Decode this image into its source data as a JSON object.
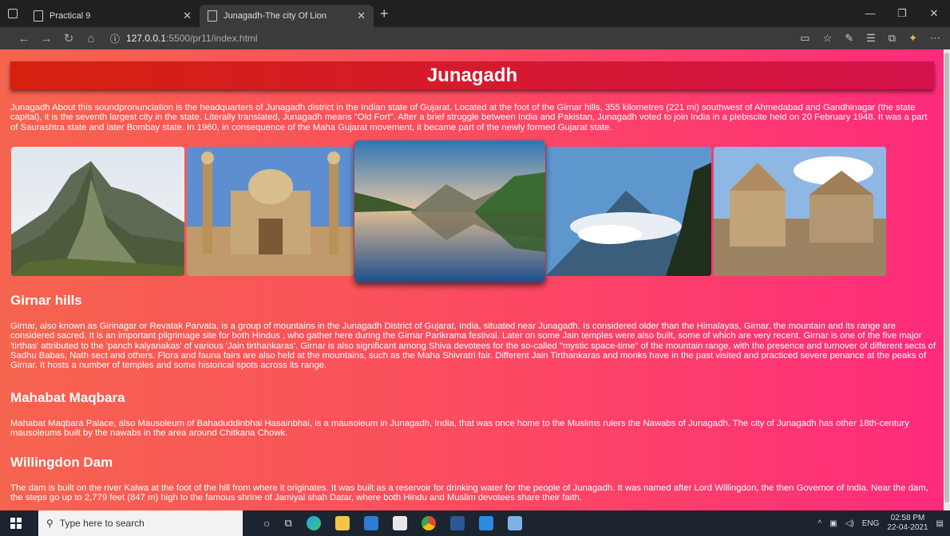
{
  "browser": {
    "tabs": [
      {
        "title": "Practical 9"
      },
      {
        "title": "Junagadh-The city Of Lion"
      }
    ],
    "url_host": "127.0.0.1",
    "url_rest": ":5500/pr11/index.html"
  },
  "page": {
    "title": "Junagadh",
    "intro": "Junagadh About this soundpronunciation is the headquarters of Junagadh district in the Indian state of Gujarat. Located at the foot of the Girnar hills, 355 kilometres (221 mi) southwest of Ahmedabad and Gandhinagar (the state capital), it is the seventh largest city in the state. Literally translated, Junagadh means \"Old Fort\". After a brief struggle between India and Pakistan, Junagadh voted to join India in a plebiscite held on 20 February 1948. It was a part of Saurashtra state and later Bombay state. In 1960, in consequence of the Maha Gujarat movement, it became part of the newly formed Gujarat state.",
    "sections": [
      {
        "heading": "Girnar hills",
        "text": "Girnar, also known as Girinagar or Revatak Parvata, is a group of mountains in the Junagadh District of Gujarat, India, situated near Junagadh. Is considered older than the Himalayas, Girnar, the mountain and its range are considered sacred. It is an important pilgrimage site for both Hindus , who gather here during the Girnar Parikrama festival. Later on some Jain temples were also built, some of which are very recent. Girnar is one of the five major 'tirthas' attributed to the 'panch kalyanakas' of various 'Jain tirthankaras'. Girnar is also significant among Shiva devotees for the so-called \"mystic space-time\" of the mountain range, with the presence and turnover of different sects of Sadhu Babas, Nath sect and others. Flora and fauna fairs are also held at the mountains, such as the Maha Shivratri fair. Different Jain Tirthankaras and monks have in the past visited and practiced severe penance at the peaks of Girnar. It hosts a number of temples and some historical spots across its range."
      },
      {
        "heading": "Mahabat Maqbara",
        "text": "Mahabat Maqbara Palace, also Mausoleum of Bahaduddinbhai Hasainbhai, is a mausoleum in Junagadh, India, that was once home to the Muslims rulers the Nawabs of Junagadh. The city of Junagadh has other 18th-century mausoleums built by the nawabs in the area around Chitkana Chowk."
      },
      {
        "heading": "Willingdon Dam",
        "text": "The dam is built on the river Kalwa at the foot of the hill from where it originates. It was built as a reservoir for drinking water for the people of Junagadh. It was named after Lord Willingdon, the then Governor of India. Near the dam, the steps go up to 2,779 feet (847 m) high to the famous shrine of Jamiyal shah Datar, where both Hindu and Muslim devotees share their faith."
      }
    ]
  },
  "taskbar": {
    "search_placeholder": "Type here to search",
    "lang": "ENG",
    "time": "02:58 PM",
    "date": "22-04-2021"
  }
}
